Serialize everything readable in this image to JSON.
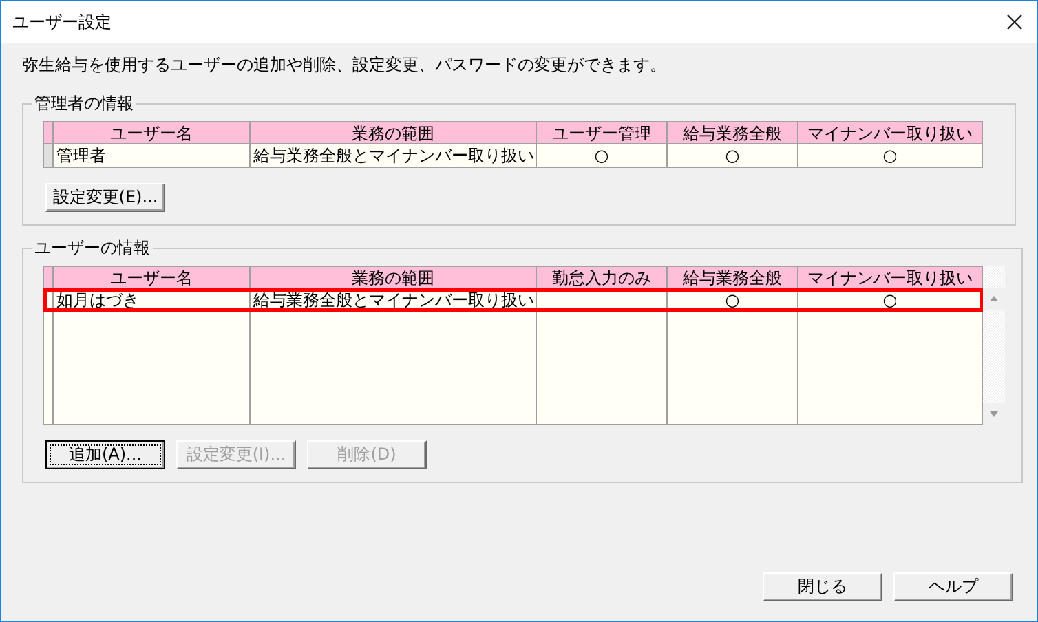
{
  "window": {
    "title": "ユーザー設定"
  },
  "description": "弥生給与を使用するユーザーの追加や削除、設定変更、パスワードの変更ができます。",
  "admin_section": {
    "title": "管理者の情報",
    "columns": [
      "ユーザー名",
      "業務の範囲",
      "ユーザー管理",
      "給与業務全般",
      "マイナンバー取り扱い"
    ],
    "rows": [
      {
        "cells": [
          "管理者",
          "給与業務全般とマイナンバー取り扱い",
          "○",
          "○",
          "○"
        ],
        "selected": false
      }
    ],
    "buttons": [
      {
        "label": "設定変更(E)...",
        "disabled": false,
        "focused": false
      }
    ]
  },
  "user_section": {
    "title": "ユーザーの情報",
    "columns": [
      "ユーザー名",
      "業務の範囲",
      "勤怠入力のみ",
      "給与業務全般",
      "マイナンバー取り扱い"
    ],
    "rows": [
      {
        "cells": [
          "如月はづき",
          "給与業務全般とマイナンバー取り扱い",
          null,
          "○",
          "○"
        ],
        "selected": true
      }
    ],
    "buttons": [
      {
        "label": "追加(A)...",
        "disabled": false,
        "focused": true
      },
      {
        "label": "設定変更(I)...",
        "disabled": true,
        "focused": false
      },
      {
        "label": "削除(D)",
        "disabled": true,
        "focused": false
      }
    ]
  },
  "footer_buttons": [
    {
      "label": "閉じる",
      "disabled": false,
      "focused": false
    },
    {
      "label": "ヘルプ",
      "disabled": false,
      "focused": false
    }
  ]
}
